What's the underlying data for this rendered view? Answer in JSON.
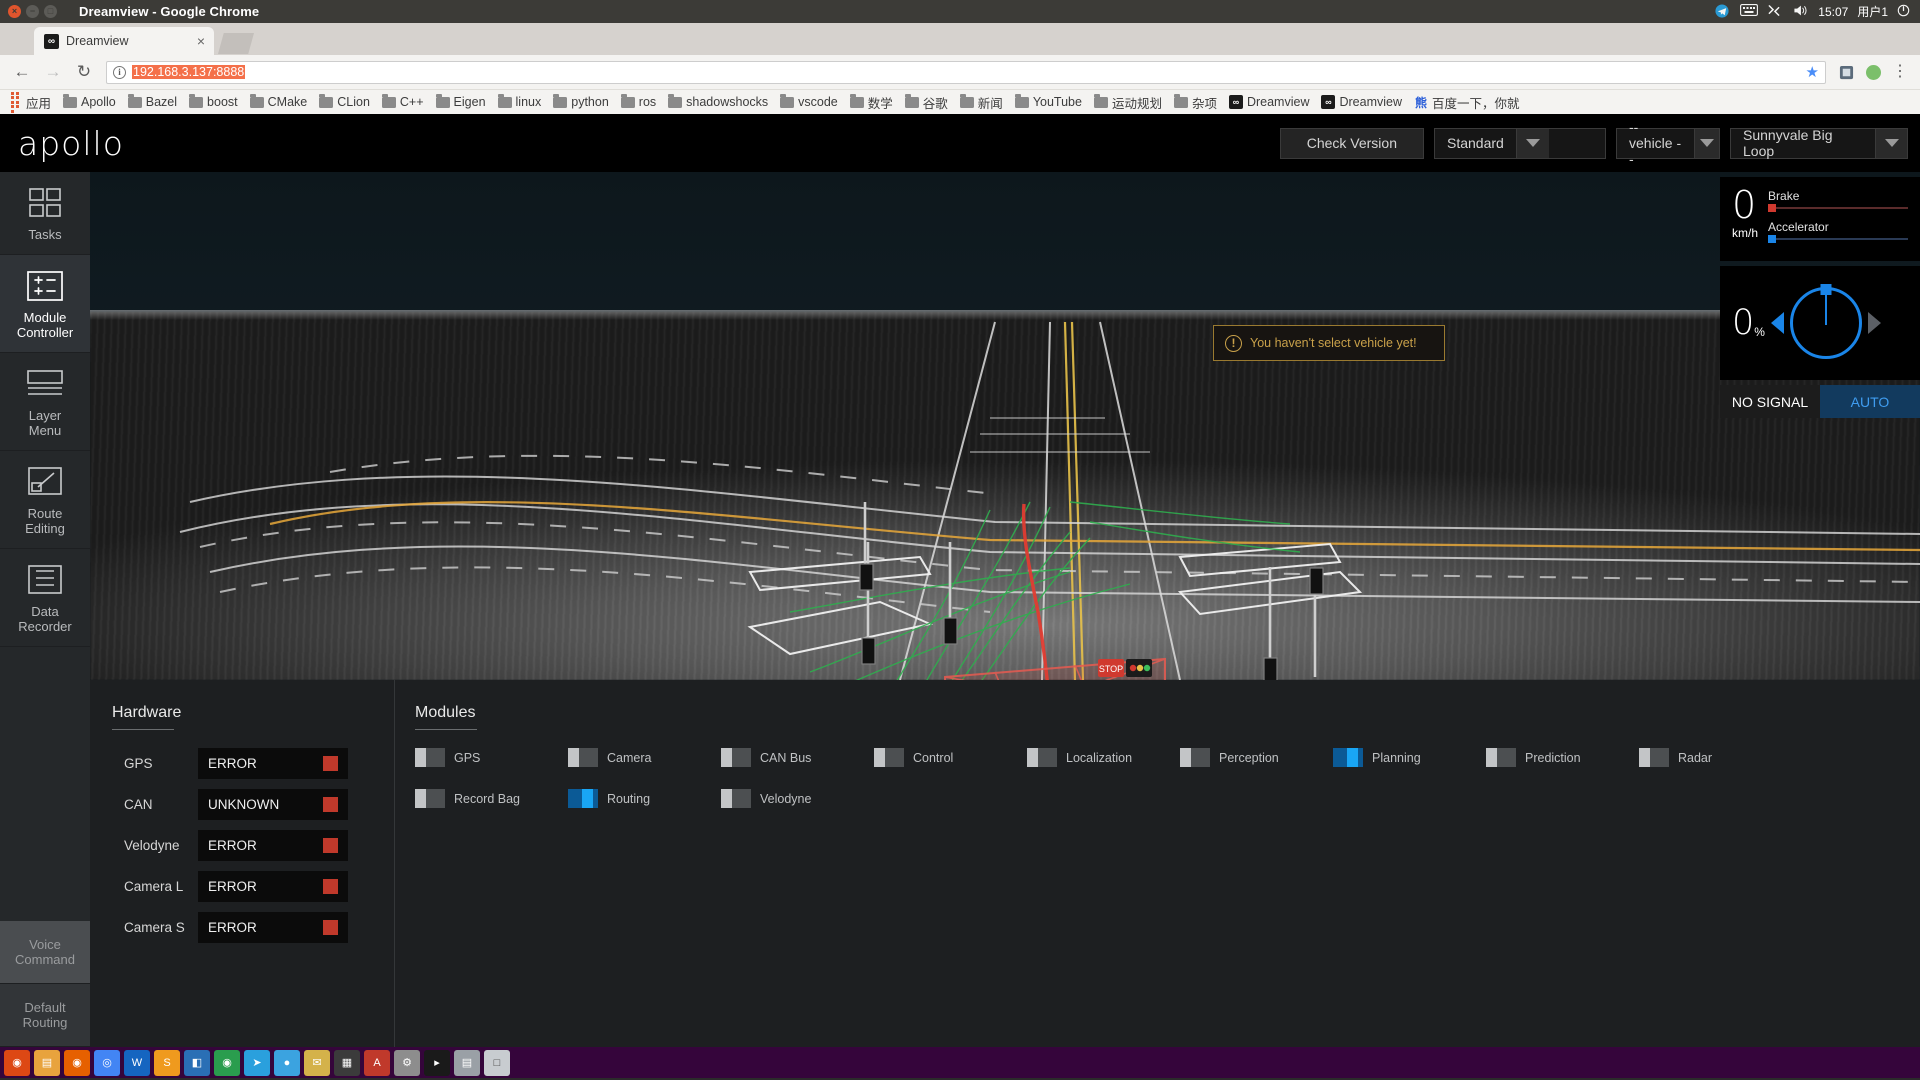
{
  "window": {
    "title": "Dreamview - Google Chrome",
    "close_glyph": "×",
    "min_glyph": "−",
    "max_glyph": "□"
  },
  "tray": {
    "time": "15:07",
    "user": "用户1",
    "icons": [
      "telegram-icon",
      "keyboard-icon",
      "network-icon",
      "volume-icon",
      "power-icon"
    ]
  },
  "tab": {
    "title": "Dreamview",
    "favicon_text": "∞",
    "close_glyph": "×"
  },
  "toolbar": {
    "back_glyph": "←",
    "forward_glyph": "→",
    "reload_glyph": "↻",
    "url": "192.168.3.137:8888",
    "info_glyph": "i",
    "star_glyph": "★",
    "menu_glyph": "⋮"
  },
  "bookmarks": [
    {
      "label": "应用",
      "icon": "apps-grid-icon"
    },
    {
      "label": "Apollo",
      "icon": "folder-icon"
    },
    {
      "label": "Bazel",
      "icon": "folder-icon"
    },
    {
      "label": "boost",
      "icon": "folder-icon"
    },
    {
      "label": "CMake",
      "icon": "folder-icon"
    },
    {
      "label": "CLion",
      "icon": "folder-icon"
    },
    {
      "label": "C++",
      "icon": "folder-icon"
    },
    {
      "label": "Eigen",
      "icon": "folder-icon"
    },
    {
      "label": "linux",
      "icon": "folder-icon"
    },
    {
      "label": "python",
      "icon": "folder-icon"
    },
    {
      "label": "ros",
      "icon": "folder-icon"
    },
    {
      "label": "shadowshocks",
      "icon": "folder-icon"
    },
    {
      "label": "vscode",
      "icon": "folder-icon"
    },
    {
      "label": "数学",
      "icon": "folder-icon"
    },
    {
      "label": "谷歌",
      "icon": "folder-icon"
    },
    {
      "label": "新闻",
      "icon": "folder-icon"
    },
    {
      "label": "YouTube",
      "icon": "folder-icon"
    },
    {
      "label": "运动规划",
      "icon": "folder-icon"
    },
    {
      "label": "杂项",
      "icon": "folder-icon"
    },
    {
      "label": "Dreamview",
      "icon": "dreamview-favicon"
    },
    {
      "label": "Dreamview",
      "icon": "dreamview-favicon"
    },
    {
      "label": "百度一下，你就",
      "icon": "baidu-icon"
    }
  ],
  "apollo": {
    "logo": "apollo",
    "header": {
      "check_version_label": "Check Version",
      "mode_value": "Standard",
      "vehicle_value": "-- vehicle --",
      "map_value": "Sunnyvale Big Loop"
    },
    "sidebar": [
      {
        "label": "Tasks",
        "icon": "grid-squares-icon",
        "active": false
      },
      {
        "label": "Module\nController",
        "icon": "module-controller-icon",
        "active": true
      },
      {
        "label": "Layer\nMenu",
        "icon": "layers-icon",
        "active": false
      },
      {
        "label": "Route\nEditing",
        "icon": "route-editing-icon",
        "active": false
      },
      {
        "label": "Data\nRecorder",
        "icon": "data-recorder-icon",
        "active": false
      }
    ],
    "sidebar_bottom": [
      {
        "label": "Voice\nCommand"
      },
      {
        "label": "Default\nRouting"
      }
    ],
    "notice": {
      "text": "You haven't select vehicle yet!",
      "icon": "warning-exclamation-icon",
      "color": "#c9a14a"
    },
    "dashboard": {
      "speed_value": "0",
      "speed_unit": "km/h",
      "brake_label": "Brake",
      "brake_color": "#d0392f",
      "accelerator_label": "Accelerator",
      "accelerator_color": "#1a85e8",
      "steering_value": "0",
      "steering_unit": "%",
      "turn_left_icon": "arrow-left-icon",
      "turn_right_icon": "arrow-right-icon",
      "signal_label": "NO SIGNAL",
      "driving_mode_label": "AUTO",
      "accent_color": "#1a85e8"
    },
    "hardware": {
      "title": "Hardware",
      "rows": [
        {
          "name": "GPS",
          "status": "ERROR",
          "led": "#c0392b"
        },
        {
          "name": "CAN",
          "status": "UNKNOWN",
          "led": "#c0392b"
        },
        {
          "name": "Velodyne",
          "status": "ERROR",
          "led": "#c0392b"
        },
        {
          "name": "Camera L",
          "status": "ERROR",
          "led": "#c0392b"
        },
        {
          "name": "Camera S",
          "status": "ERROR",
          "led": "#c0392b"
        }
      ]
    },
    "modules": {
      "title": "Modules",
      "items": [
        {
          "label": "GPS",
          "on": false
        },
        {
          "label": "Camera",
          "on": false
        },
        {
          "label": "CAN Bus",
          "on": false
        },
        {
          "label": "Control",
          "on": false
        },
        {
          "label": "Localization",
          "on": false
        },
        {
          "label": "Perception",
          "on": false
        },
        {
          "label": "Planning",
          "on": true
        },
        {
          "label": "Prediction",
          "on": false
        },
        {
          "label": "Radar",
          "on": false
        },
        {
          "label": "Record Bag",
          "on": false
        },
        {
          "label": "Routing",
          "on": true
        },
        {
          "label": "Velodyne",
          "on": false
        }
      ]
    }
  },
  "launcher": {
    "items": [
      {
        "name": "ubuntu-dash-icon",
        "color": "#dd4814",
        "glyph": "◉"
      },
      {
        "name": "files-icon",
        "color": "#e8a33d",
        "glyph": "▤"
      },
      {
        "name": "firefox-icon",
        "color": "#e66000",
        "glyph": "◉"
      },
      {
        "name": "chrome-icon",
        "color": "#4285f4",
        "glyph": "◎"
      },
      {
        "name": "wps-icon",
        "color": "#1565c0",
        "glyph": "W"
      },
      {
        "name": "sublime-icon",
        "color": "#ef9a1e",
        "glyph": "S"
      },
      {
        "name": "vscode-icon",
        "color": "#2a6fb5",
        "glyph": "◧"
      },
      {
        "name": "browser2-icon",
        "color": "#2a9d4e",
        "glyph": "◉"
      },
      {
        "name": "telegram-icon",
        "color": "#2aa0dd",
        "glyph": "➤"
      },
      {
        "name": "qq-icon",
        "color": "#3ba3e0",
        "glyph": "●"
      },
      {
        "name": "mail-icon",
        "color": "#d4b24a",
        "glyph": "✉"
      },
      {
        "name": "calculator-icon",
        "color": "#3b3b3b",
        "glyph": "▦"
      },
      {
        "name": "pdf-icon",
        "color": "#c0392b",
        "glyph": "A"
      },
      {
        "name": "settings-icon",
        "color": "#8d8d8d",
        "glyph": "⚙"
      },
      {
        "name": "terminal-icon",
        "color": "#1a1a1a",
        "glyph": "▸"
      },
      {
        "name": "archive-icon",
        "color": "#9aa0a6",
        "glyph": "▤"
      },
      {
        "name": "trash-icon",
        "color": "#c8ccd0",
        "glyph": "□"
      }
    ]
  }
}
